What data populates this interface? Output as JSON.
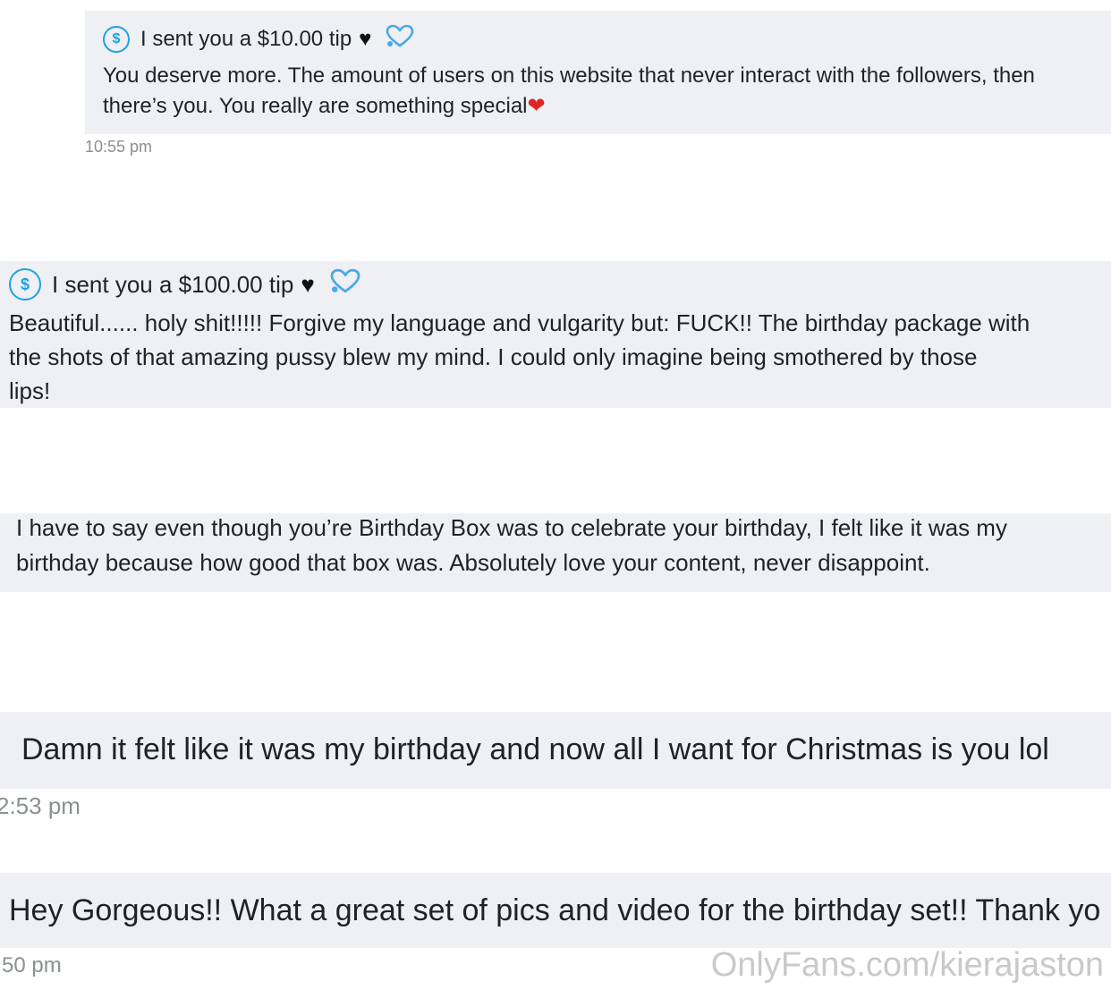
{
  "messages": [
    {
      "tip_text": "I sent you a $10.00 tip",
      "black_heart": "♥",
      "body_line1": "You deserve more. The amount of users on this website that never interact with the followers, then",
      "body_line2": "there’s you. You really are something special",
      "emoji": "❤",
      "time": "10:55 pm"
    },
    {
      "tip_text": "I sent you a $100.00 tip",
      "black_heart": "♥",
      "body": "Beautiful...... holy shit!!!!! Forgive my language and vulgarity but: FUCK!! The birthday package with\nthe shots of that amazing pussy blew my mind. I could only imagine being smothered by those\nlips!"
    },
    {
      "body": "I have to say even though you’re Birthday Box was to celebrate your birthday, I felt like it was my\nbirthday because how good that box was. Absolutely love your content, never disappoint."
    },
    {
      "body": "Damn it felt like it was my birthday and now all I want for Christmas is you lol",
      "time": "2:53 pm"
    },
    {
      "body": "Hey Gorgeous!! What a great set of pics and video for the birthday set!! Thank yo",
      "time": "50 pm"
    }
  ],
  "icons": {
    "dollar_symbol": "$",
    "dollar_color": "#1da1e6",
    "heart_outline_color": "#4aa8e8"
  },
  "watermark": "OnlyFans.com/kierajaston"
}
